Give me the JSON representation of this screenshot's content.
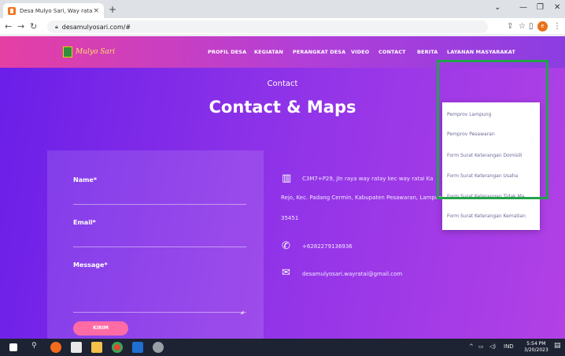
{
  "browser": {
    "tab_title": "Desa Mulyo Sari, Way ratai",
    "tab_close": "×",
    "new_tab": "+",
    "url": "desamulyosari.com/#",
    "profile_initial": "e",
    "win_minimize": "—",
    "win_restore": "❐",
    "win_close": "✕",
    "chevron": "⌄"
  },
  "nav": {
    "logo_text": "Mulyo Sari",
    "items": [
      "PROFIL DESA",
      "KEGIATAN",
      "PERANGKAT DESA",
      "VIDEO",
      "CONTACT",
      "BERITA",
      "LAYANAN MASYARAKAT"
    ]
  },
  "hero": {
    "subtitle": "Contact",
    "title": "Contact & Maps"
  },
  "form": {
    "name_label": "Name*",
    "email_label": "Email*",
    "message_label": "Message*",
    "submit_label": "KIRIM"
  },
  "contact_info": {
    "address_line1": "C3M7+P29, Jln raya way ratay kec way ratai Ka",
    "address_line2": "Rejo, Kec. Padang Cermin, Kabupaten Pesawaran, Lampung",
    "postal": "35451",
    "phone": "+6282279136936",
    "email": "desamulyosari.wayratai@gmail.com"
  },
  "dropdown": {
    "items": [
      "Pemprov Lampung",
      "Pemprov Pesawaran",
      "Form Surat Keterangan Domisili",
      "Form Surat Keterangan Usaha",
      "Form Surat Keterangan Tidak Ma...",
      "Form Surat Keterangan Kematian"
    ]
  },
  "taskbar": {
    "lang": "IND",
    "time": "5:54 PM",
    "date": "3/20/2023"
  },
  "colors": {
    "nav_gradient_start": "#e53fa4",
    "page_gradient_start": "#6a1ee8",
    "submit_button": "#ff6ba5",
    "highlight_border": "#22a34a"
  }
}
